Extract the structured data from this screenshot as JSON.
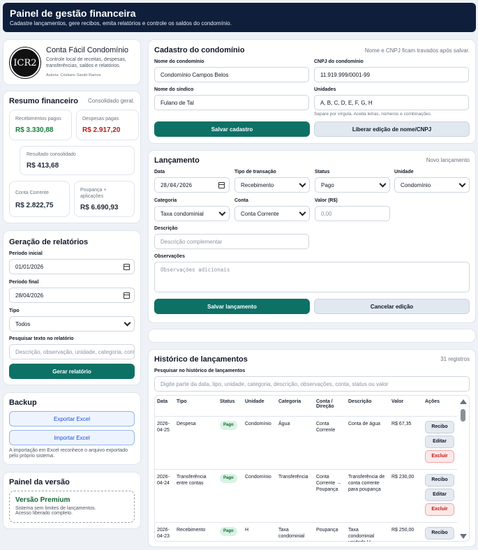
{
  "header": {
    "title": "Painel de gestão financeira",
    "subtitle": "Cadastre lançamentos, gere recibos, emita relatórios e controle os saldos do condomínio."
  },
  "brand": {
    "logo_text": "ICR2",
    "name": "Conta Fácil Condomínio",
    "description": "Controle local de receitas, despesas, transferências, saldos e relatórios.",
    "author": "Autoria: Cristiano Sandri Ramos"
  },
  "summary": {
    "title": "Resumo financeiro",
    "note": "Consolidado geral.",
    "received_label": "Recebimentos pagos",
    "received_value": "R$ 3.330,88",
    "expenses_label": "Despesas pagas",
    "expenses_value": "R$ 2.917,20",
    "result_label": "Resultado consolidado",
    "result_value": "R$ 413,68",
    "checking_label": "Conta Corrente",
    "checking_value": "R$ 2.822,75",
    "savings_label": "Poupança + aplicações",
    "savings_value": "R$ 6.690,93"
  },
  "reports": {
    "title": "Geração de relatórios",
    "start_label": "Período inicial",
    "start_value": "01/01/2026",
    "end_label": "Período final",
    "end_value": "28/04/2026",
    "type_label": "Tipo",
    "type_value": "Todos",
    "search_label": "Pesquisar texto no relatório",
    "search_placeholder": "Descrição, observação, unidade, categoria, conta",
    "generate_label": "Gerar relatório"
  },
  "backup": {
    "title": "Backup",
    "export_label": "Exportar Excel",
    "import_label": "Importar Excel",
    "note": "A importação em Excel reconhece o arquivo exportado pelo próprio sistema."
  },
  "version": {
    "title": "Painel da versão",
    "name": "Versão Premium",
    "line1": "Sistema sem limites de lançamentos.",
    "line2": "Acesso liberado completo."
  },
  "registration": {
    "title": "Cadastro do condomínio",
    "note": "Nome e CNPJ ficam travados após salvar.",
    "name_label": "Nome do condomínio",
    "name_value": "Condomínio Campos Belos",
    "cnpj_label": "CNPJ do condomínio",
    "cnpj_value": "11.919.999/0001-99",
    "syndic_label": "Nome do síndico",
    "syndic_value": "Fulano de Tal",
    "units_label": "Unidades",
    "units_value": "A, B, C, D, E, F, G, H",
    "units_hint": "Separe por vírgula. Aceita letras, números e combinações.",
    "save_label": "Salvar cadastro",
    "unlock_label": "Liberar edição de nome/CNPJ"
  },
  "entry": {
    "title": "Lançamento",
    "note": "Novo lançamento",
    "date_label": "Data",
    "date_value": "28/04/2026",
    "type_label": "Tipo de transação",
    "type_value": "Recebimento",
    "status_label": "Status",
    "status_value": "Pago",
    "unit_label": "Unidade",
    "unit_value": "Condomínio",
    "category_label": "Categoria",
    "category_value": "Taxa condominial",
    "account_label": "Conta",
    "account_value": "Conta Corrente",
    "amount_label": "Valor (R$)",
    "amount_placeholder": "0,00",
    "description_label": "Descrição",
    "description_placeholder": "Descrição complementar",
    "notes_label": "Observações",
    "notes_placeholder": "Observações adicionais",
    "save_label": "Salvar lançamento",
    "cancel_label": "Cancelar edição"
  },
  "history": {
    "title": "Histórico de lançamentos",
    "count": "31 registros",
    "search_label": "Pesquisar no histórico de lançamentos",
    "search_placeholder": "Digite parte da data, tipo, unidade, categoria, descrição, observações, conta, status ou valor",
    "columns": [
      "Data",
      "Tipo",
      "Status",
      "Unidade",
      "Categoria",
      "Conta / Direção",
      "Descrição",
      "Valor",
      "Ações"
    ],
    "receipt_label": "Recibo",
    "edit_label": "Editar",
    "delete_label": "Excluir",
    "rows": [
      {
        "date": "2026-04-25",
        "type": "Despesa",
        "status": "Pago",
        "unit": "Condomínio",
        "category": "Água",
        "account": "Conta Corrente",
        "description": "Conta de água",
        "value": "R$ 67,35"
      },
      {
        "date": "2026-04-24",
        "type": "Transferência entre contas",
        "status": "Pago",
        "unit": "Condomínio",
        "category": "Transferência",
        "account": "Conta Corrente → Poupança",
        "description": "Transferência de conta corrente para poupança",
        "value": "R$ 230,00"
      },
      {
        "date": "2026-04-23",
        "type": "Recebimento",
        "status": "Pago",
        "unit": "H",
        "category": "Taxa condominial",
        "account": "Poupança",
        "description": "Taxa condominial unidade H",
        "value": "R$ 250,00"
      }
    ]
  }
}
